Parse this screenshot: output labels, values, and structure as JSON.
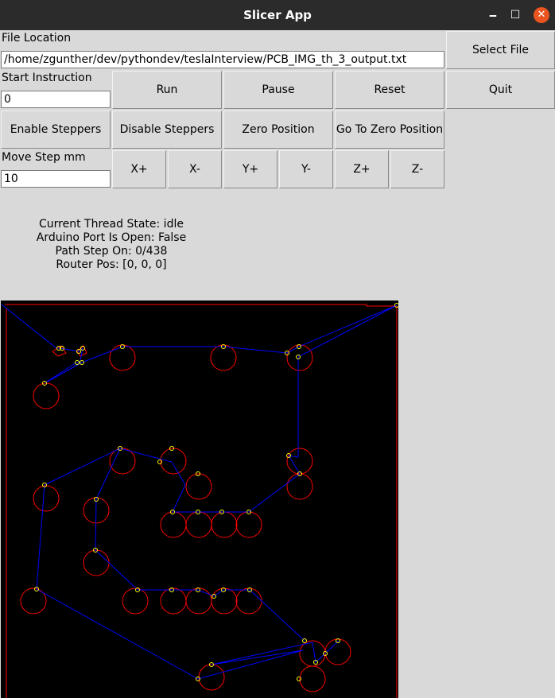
{
  "window": {
    "title": "Slicer App",
    "minimize": "🗕",
    "maximize": "☐",
    "close": "✕"
  },
  "file": {
    "label": "File Location",
    "value": "/home/zgunther/dev/pythondev/teslaInterview/PCB_IMG_th_3_output.txt"
  },
  "start": {
    "label": "Start Instruction",
    "value": "0"
  },
  "move": {
    "label": "Move Step mm",
    "value": "10"
  },
  "buttons": {
    "select_file": "Select File",
    "run": "Run",
    "pause": "Pause",
    "reset": "Reset",
    "quit": "Quit",
    "enable": "Enable Steppers",
    "disable": "Disable Steppers",
    "zero": "Zero Position",
    "goto_zero": "Go To Zero Position",
    "xp": "X+",
    "xm": "X-",
    "yp": "Y+",
    "ym": "Y-",
    "zp": "Z+",
    "zm": "Z-"
  },
  "status": {
    "thread": "Current Thread State: idle",
    "port": "Arduino Port Is Open: False",
    "step": "Path Step On: 0/438",
    "pos": "Router Pos: [0, 0, 0]"
  },
  "preview": {
    "background": "#000000",
    "outline_color": "#ff0000",
    "path_color": "#0000ff",
    "marker_color": "#ffff00"
  }
}
